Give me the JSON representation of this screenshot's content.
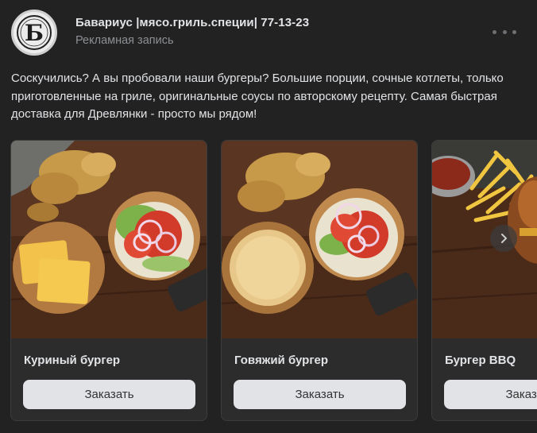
{
  "post": {
    "author": "Бавариус |мясо.гриль.специи| 77-13-23",
    "subtitle": "Рекламная запись",
    "text": "Соскучились? А вы пробовали наши бургеры? Большие порции, сочные котлеты, только приготовленные на гриле, оригинальные соусы по авторскому рецепту. Самая быстрая доставка для Древлянки - просто мы рядом!",
    "avatar_letter": "Б"
  },
  "carousel": {
    "cards": [
      {
        "name": "Куриный бургер",
        "button": "Заказать",
        "image": "chicken-burger-photo"
      },
      {
        "name": "Говяжий бургер",
        "button": "Заказать",
        "image": "beef-burger-photo"
      },
      {
        "name": "Бургер BBQ",
        "button": "Заказать",
        "image": "bbq-burger-photo"
      }
    ]
  },
  "icons": {
    "more": "more-horizontal-icon",
    "next": "chevron-right-icon"
  },
  "colors": {
    "background": "#222222",
    "card": "#2c2c2c",
    "button": "#e1e3e6",
    "text_primary": "#e1e3e6",
    "text_secondary": "#8c8f93"
  }
}
